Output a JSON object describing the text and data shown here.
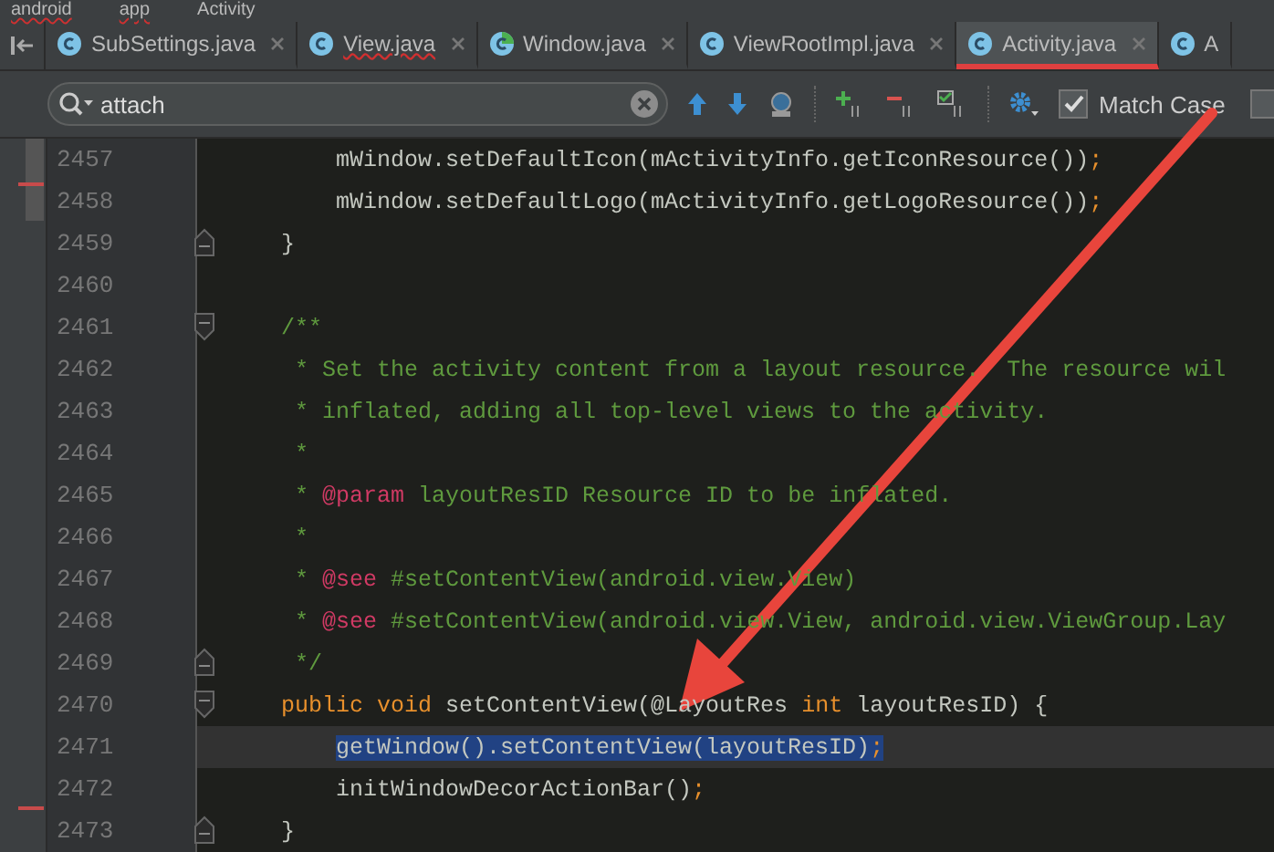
{
  "breadcrumb": [
    {
      "label": "android",
      "error": true
    },
    {
      "label": "app",
      "error": true
    },
    {
      "label": "Activity",
      "error": false
    }
  ],
  "tabs": [
    {
      "label": "SubSettings.java",
      "selected": false,
      "error": false,
      "kind": "class"
    },
    {
      "label": "View.java",
      "selected": false,
      "error": true,
      "kind": "class"
    },
    {
      "label": "Window.java",
      "selected": false,
      "error": false,
      "kind": "abstract"
    },
    {
      "label": "ViewRootImpl.java",
      "selected": false,
      "error": false,
      "kind": "class"
    },
    {
      "label": "Activity.java",
      "selected": true,
      "error": false,
      "kind": "class"
    },
    {
      "label": "A",
      "selected": false,
      "error": false,
      "kind": "class"
    }
  ],
  "search": {
    "value": "attach",
    "match_case": {
      "label": "Match Case",
      "checked": true
    },
    "option_2": {
      "checked": false
    }
  },
  "lines": [
    {
      "number": "2457",
      "kind": "plain",
      "current": false,
      "segments": [
        {
          "text": "        mWindow.setDefaultIcon(mActivityInfo.getIconResource())",
          "kind": "plain"
        },
        {
          "text": ";",
          "kind": "punct"
        }
      ]
    },
    {
      "number": "2458",
      "kind": "plain",
      "current": false,
      "segments": [
        {
          "text": "        mWindow.setDefaultLogo(mActivityInfo.getLogoResource())",
          "kind": "plain"
        },
        {
          "text": ";",
          "kind": "punct"
        }
      ]
    },
    {
      "number": "2459",
      "kind": "fold-end",
      "current": false,
      "segments": [
        {
          "text": "    }",
          "kind": "plain"
        }
      ]
    },
    {
      "number": "2460",
      "kind": "plain",
      "current": false
    },
    {
      "number": "2461",
      "kind": "fold-start",
      "current": false,
      "segments": [
        {
          "text": "    /**",
          "kind": "comment"
        }
      ]
    },
    {
      "number": "2462",
      "kind": "plain",
      "current": false,
      "segments": [
        {
          "text": "     * Set the activity content from a layout resource.  The resource wil",
          "kind": "comment"
        }
      ]
    },
    {
      "number": "2463",
      "kind": "plain",
      "current": false,
      "segments": [
        {
          "text": "     * inflated, adding all top-level views to the activity.",
          "kind": "comment"
        }
      ]
    },
    {
      "number": "2464",
      "kind": "plain",
      "current": false,
      "segments": [
        {
          "text": "     *",
          "kind": "comment"
        }
      ]
    },
    {
      "number": "2465",
      "kind": "plain",
      "current": false,
      "segments": [
        {
          "text": "     * ",
          "kind": "comment"
        },
        {
          "text": "@param",
          "kind": "doctag"
        },
        {
          "text": " layoutResID Resource ID to be inflated.",
          "kind": "comment"
        }
      ]
    },
    {
      "number": "2466",
      "kind": "plain",
      "current": false,
      "segments": [
        {
          "text": "     *",
          "kind": "comment"
        }
      ]
    },
    {
      "number": "2467",
      "kind": "plain",
      "current": false,
      "segments": [
        {
          "text": "     * ",
          "kind": "comment"
        },
        {
          "text": "@see",
          "kind": "doctag"
        },
        {
          "text": " #setContentView(android.view.View)",
          "kind": "comment"
        }
      ]
    },
    {
      "number": "2468",
      "kind": "plain",
      "current": false,
      "segments": [
        {
          "text": "     * ",
          "kind": "comment"
        },
        {
          "text": "@see",
          "kind": "doctag"
        },
        {
          "text": " #setContentView(android.view.View, android.view.ViewGroup.Lay",
          "kind": "comment"
        }
      ]
    },
    {
      "number": "2469",
      "kind": "fold-end",
      "current": false,
      "segments": [
        {
          "text": "     */",
          "kind": "comment"
        }
      ]
    },
    {
      "number": "2470",
      "kind": "fold-start",
      "current": false,
      "segments": [
        {
          "text": "    public void",
          "kind": "keyword"
        },
        {
          "text": " setContentView(@LayoutRes ",
          "kind": "plain"
        },
        {
          "text": "int",
          "kind": "keyword"
        },
        {
          "text": " layoutResID) {",
          "kind": "plain"
        }
      ]
    },
    {
      "number": "2471",
      "kind": "plain",
      "current": true,
      "segments": [
        {
          "text": "        getWindow().setContentView(layoutResID)",
          "kind": "plain",
          "selected": true
        },
        {
          "text": ";",
          "kind": "punct",
          "selected": true
        }
      ]
    },
    {
      "number": "2472",
      "kind": "plain",
      "current": false,
      "segments": [
        {
          "text": "        initWindowDecorActionBar()",
          "kind": "plain"
        },
        {
          "text": ";",
          "kind": "punct"
        }
      ]
    },
    {
      "number": "2473",
      "kind": "fold-end",
      "current": false,
      "segments": [
        {
          "text": "    }",
          "kind": "plain"
        }
      ]
    }
  ]
}
